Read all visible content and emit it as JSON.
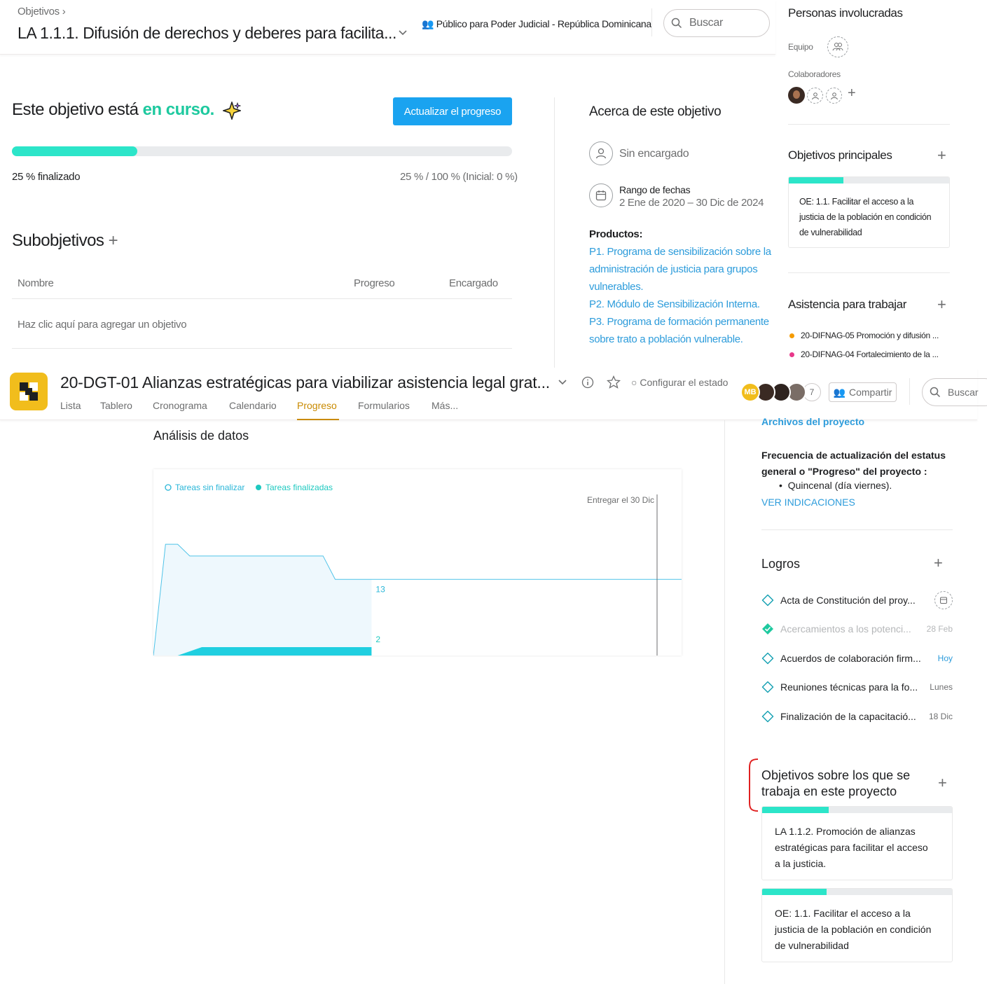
{
  "top": {
    "breadcrumb": "Objetivos",
    "title": "LA 1.1.1. Difusión de derechos y deberes para facilita...",
    "public_label": "Público para Poder Judicial - República Dominicana",
    "search_placeholder": "Buscar",
    "status_prefix": "Este objetivo está ",
    "status_value": "en curso.",
    "update_button": "Actualizar el progreso",
    "progress_percent": 25,
    "progress_done_label": "25 % finalizado",
    "progress_ratio": "25 % / 100 % (Inicial: 0 %)",
    "subgoals_heading": "Subobjetivos",
    "columns": {
      "name": "Nombre",
      "progress": "Progreso",
      "owner": "Encargado"
    },
    "add_goal_text": "Haz clic aquí para agregar un objetivo",
    "about_heading": "Acerca de este objetivo",
    "assignee": "Sin encargado",
    "date_range_label": "Rango de fechas",
    "date_range_value": "2 Ene de 2020 – 30 Dic de 2024",
    "products_label": "Productos:",
    "products": [
      "P1. Programa de sensibilización sobre la administración de justicia para grupos vulnerables.",
      "P2. Módulo de Sensibilización Interna.",
      "P3. Programa de formación permanente sobre trato a población vulnerable."
    ],
    "people_heading": "Personas involucradas",
    "team_label": "Equipo",
    "collaborators_label": "Colaboradores",
    "main_goals_heading": "Objetivos principales",
    "main_goal_card": {
      "text": "OE: 1.1. Facilitar el acceso a la justicia de la población en condición de vulnerabilidad",
      "progress": 0.34
    },
    "work_heading": "Asistencia para trabajar",
    "work_items": [
      {
        "label": "20-DIFNAG-05 Promoción y difusión ...",
        "color": "#f59b00"
      },
      {
        "label": "20-DIFNAG-04 Fortalecimiento de la ...",
        "color": "#e8388a"
      }
    ]
  },
  "project": {
    "title": "20-DGT-01 Alianzas estratégicas para viabilizar asistencia legal grat...",
    "set_status": "Configurar el estado",
    "member_initials": "MB",
    "member_count": "7",
    "share_button": "Compartir",
    "search_placeholder": "Buscar",
    "tabs": [
      "Lista",
      "Tablero",
      "Cronograma",
      "Calendario",
      "Progreso",
      "Formularios",
      "Más..."
    ],
    "active_tab": "Progreso",
    "analysis_heading": "Análisis de datos",
    "files_link": "Archivos del proyecto",
    "frequency_text": "Frecuencia de actualización del estatus general o \"Progreso\" del proyecto :",
    "frequency_item": "Quincenal (día viernes).",
    "view_link": "VER INDICACIONES",
    "logros_heading": "Logros",
    "milestones": [
      {
        "name": "Acta de Constitución del proy...",
        "date": "",
        "done": false
      },
      {
        "name": "Acercamientos a los potenci...",
        "date": "28 Feb",
        "done": true
      },
      {
        "name": "Acuerdos de colaboración firm...",
        "date": "Hoy",
        "done": false
      },
      {
        "name": "Reuniones técnicas para la fo...",
        "date": "Lunes",
        "done": false
      },
      {
        "name": "Finalización de la capacitació...",
        "date": "18 Dic",
        "done": false
      }
    ],
    "goals_heading": "Objetivos sobre los que se trabaja en este proyecto",
    "goal_cards": [
      {
        "text": "LA 1.1.2. Promoción de alianzas estratégicas para facilitar el acceso a la justicia.",
        "progress": 0.35
      },
      {
        "text": "OE: 1.1. Facilitar el acceso a la justicia de la población en condición de vulnerabilidad",
        "progress": 0.34
      }
    ]
  },
  "colors": {
    "accent_teal": "#2ce5c9",
    "link_blue": "#2d9cdb",
    "button_blue": "#1aa3f0",
    "active_tab": "#c98a00",
    "logo_yellow": "#f1bd1c"
  },
  "chart_data": {
    "type": "area",
    "legend": [
      "Tareas sin finalizar",
      "Tareas finalizadas"
    ],
    "legend_position": "top-left",
    "deadline_label": "Entregar el 30 Dic",
    "series": [
      {
        "name": "Tareas sin finalizar",
        "values": [
          0,
          19,
          19,
          17,
          17,
          17,
          17,
          17,
          17,
          17,
          17,
          17,
          17,
          17,
          17,
          13,
          13,
          13,
          13,
          13,
          13,
          13,
          13,
          13,
          13,
          13,
          13,
          13,
          13,
          13,
          13,
          13,
          13,
          13,
          13,
          13,
          13,
          13,
          13,
          13,
          13,
          13,
          13,
          13,
          13,
          13
        ]
      },
      {
        "name": "Tareas finalizadas",
        "values": [
          0,
          0,
          0,
          1,
          2,
          2,
          2,
          2,
          2,
          2,
          2,
          2,
          2,
          2,
          2,
          2,
          2,
          2,
          2,
          2,
          2,
          2,
          2,
          2,
          2,
          2,
          2,
          2,
          2,
          2,
          2,
          2,
          2,
          2,
          2,
          2,
          2,
          2,
          2,
          2,
          2,
          2,
          2,
          2,
          2,
          2
        ]
      }
    ],
    "current_labels": {
      "incomplete": "13",
      "completed": "2"
    },
    "ylim": [
      0,
      22
    ],
    "grid": false
  }
}
